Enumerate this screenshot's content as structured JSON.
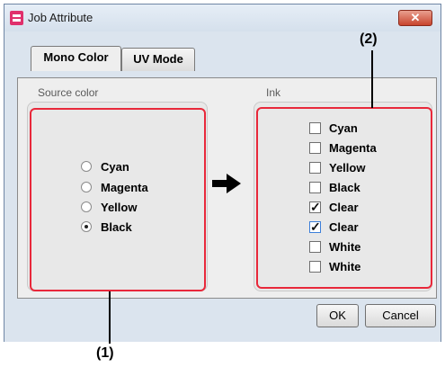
{
  "window": {
    "title": "Job Attribute",
    "close_label": "✕"
  },
  "tabs": [
    {
      "label": "Mono Color",
      "active": true
    },
    {
      "label": "UV Mode",
      "active": false
    }
  ],
  "source": {
    "label": "Source color",
    "options": [
      {
        "label": "Cyan",
        "selected": false
      },
      {
        "label": "Magenta",
        "selected": false
      },
      {
        "label": "Yellow",
        "selected": false
      },
      {
        "label": "Black",
        "selected": true
      }
    ]
  },
  "ink": {
    "label": "Ink",
    "options": [
      {
        "label": "Cyan",
        "checked": false
      },
      {
        "label": "Magenta",
        "checked": false
      },
      {
        "label": "Yellow",
        "checked": false
      },
      {
        "label": "Black",
        "checked": false
      },
      {
        "label": "Clear",
        "checked": true
      },
      {
        "label": "Clear",
        "checked": true
      },
      {
        "label": "White",
        "checked": false
      },
      {
        "label": "White",
        "checked": false
      }
    ]
  },
  "buttons": {
    "ok": "OK",
    "cancel": "Cancel"
  },
  "callouts": {
    "one": "(1)",
    "two": "(2)"
  },
  "icons": {
    "app": "app-logo-icon",
    "arrow": "right-arrow-icon",
    "close": "close-icon"
  },
  "colors": {
    "highlight": "#e8283a",
    "close_button": "#c8442d"
  }
}
